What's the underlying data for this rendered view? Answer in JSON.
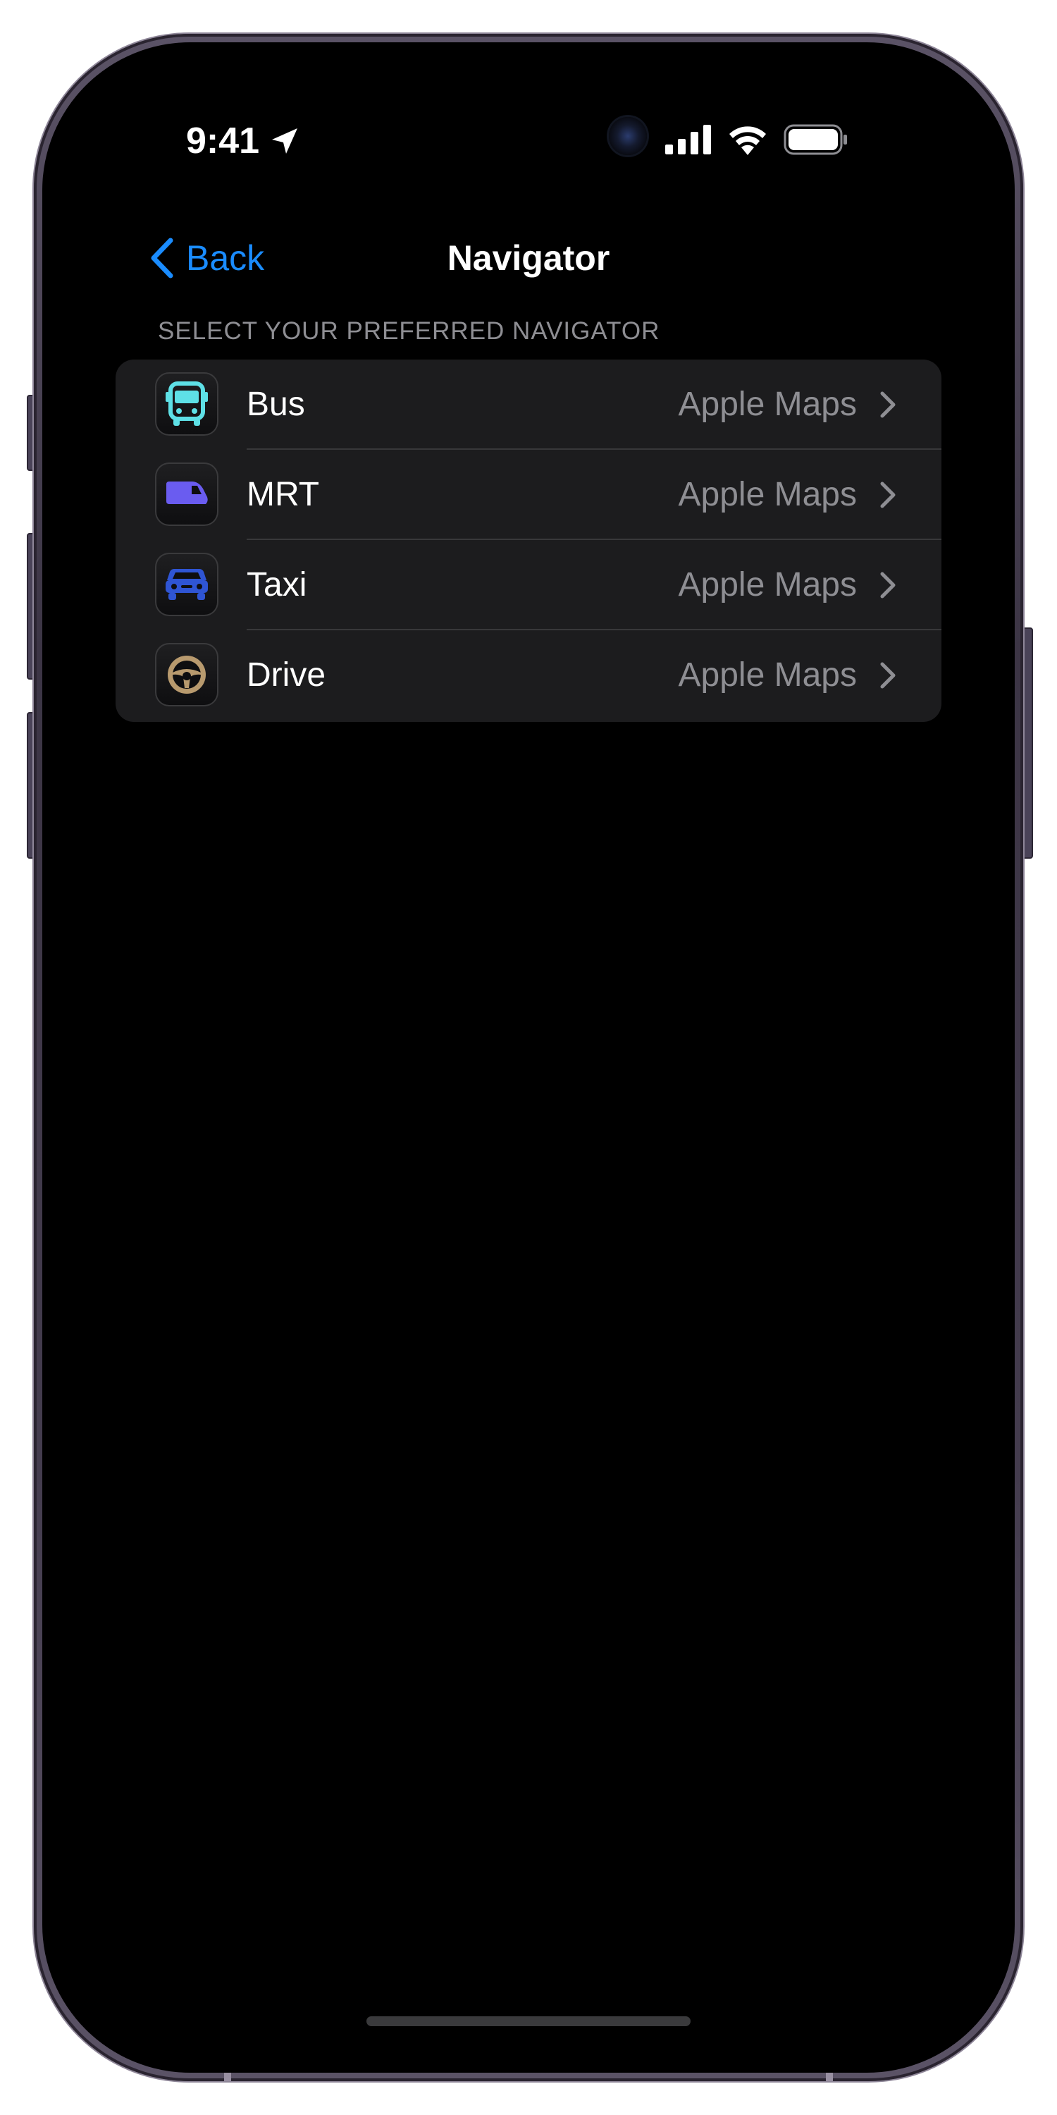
{
  "status_bar": {
    "time": "9:41"
  },
  "nav": {
    "back_label": "Back",
    "title": "Navigator"
  },
  "section": {
    "header": "SELECT YOUR PREFERRED NAVIGATOR"
  },
  "rows": [
    {
      "label": "Bus",
      "value": "Apple Maps",
      "icon": "bus-icon",
      "icon_color": "#5ee0e6"
    },
    {
      "label": "MRT",
      "value": "Apple Maps",
      "icon": "train-icon",
      "icon_color": "#6a5cf0"
    },
    {
      "label": "Taxi",
      "value": "Apple Maps",
      "icon": "car-icon",
      "icon_color": "#2f55d4"
    },
    {
      "label": "Drive",
      "value": "Apple Maps",
      "icon": "steering-wheel-icon",
      "icon_color": "#b89a6e"
    }
  ],
  "colors": {
    "accent": "#1a8cff",
    "background": "#000000",
    "group_background": "#1c1c1e",
    "secondary_text": "#8e8e93"
  }
}
